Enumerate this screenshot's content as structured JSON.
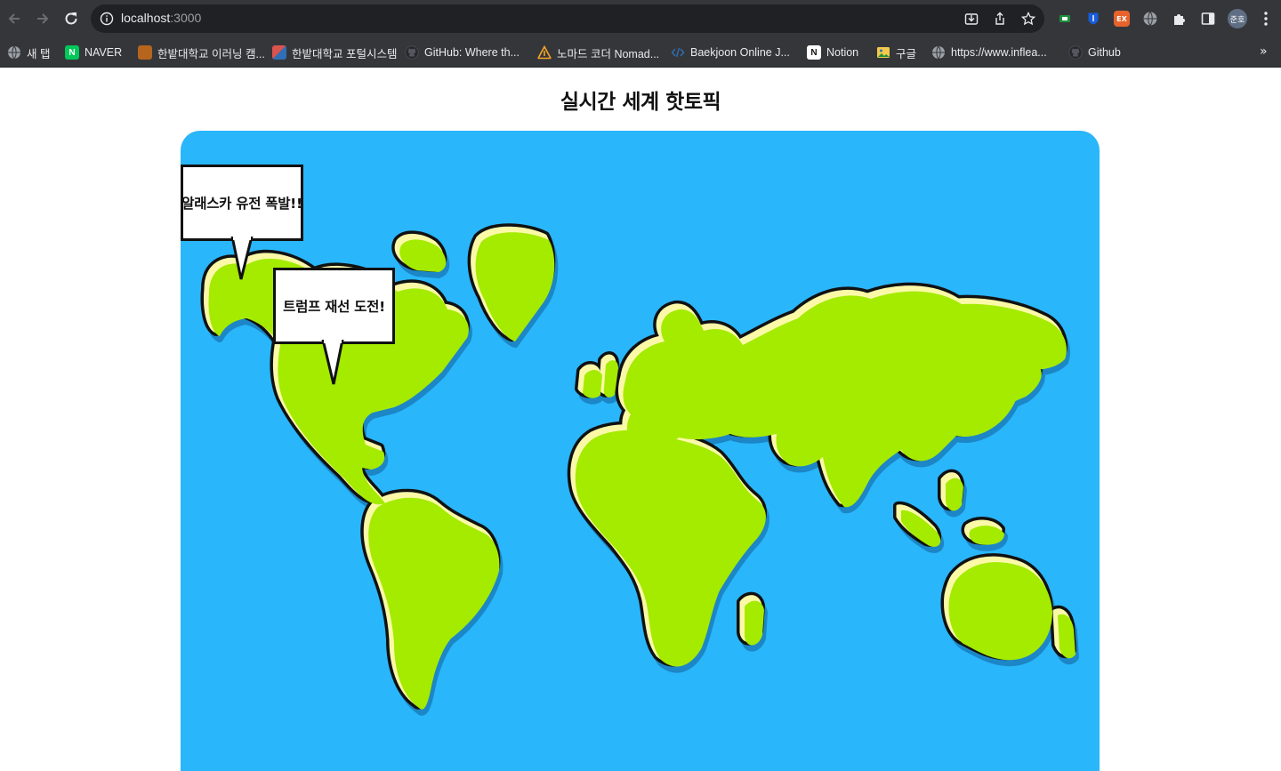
{
  "browser": {
    "url_host": "localhost",
    "url_port": ":3000",
    "profile_initials": "준호",
    "bookmarks_more": "»",
    "bookmarks": [
      {
        "label": "새 탭"
      },
      {
        "label": "NAVER",
        "icon_text": "N",
        "color": "#03c75a"
      },
      {
        "label": "한밭대학교 이러닝 캠...",
        "color": "#b5651d"
      },
      {
        "label": "한밭대학교 포털시스템",
        "color": "#d9534f"
      },
      {
        "label": "GitHub: Where th..."
      },
      {
        "label": "노마드 코더 Nomad...",
        "color": "#f5a623"
      },
      {
        "label": "Baekjoon Online J...",
        "color": "#2f6fb5"
      },
      {
        "label": "Notion",
        "icon_text": "N"
      },
      {
        "label": "구글"
      },
      {
        "label": "https://www.inflea..."
      },
      {
        "label": "Github"
      }
    ],
    "extensions": [
      {
        "name": "extension-green",
        "color": "#1e8e3e"
      },
      {
        "name": "extension-bitwarden",
        "color": "#175ddc"
      },
      {
        "name": "extension-ex",
        "icon_text": "EX",
        "color": "#e8632b"
      },
      {
        "name": "extension-globe",
        "color": "#9aa0a6"
      }
    ]
  },
  "page": {
    "title": "실시간 세계 핫토픽"
  },
  "topics": [
    {
      "text": "알래스카 유전 폭발!!"
    },
    {
      "text": "트럼프 재선 도전!"
    }
  ],
  "colors": {
    "ocean": "#29b6fb",
    "land": "#a4eb00",
    "land_highlight": "#fbf9a8",
    "outline": "#111111"
  }
}
